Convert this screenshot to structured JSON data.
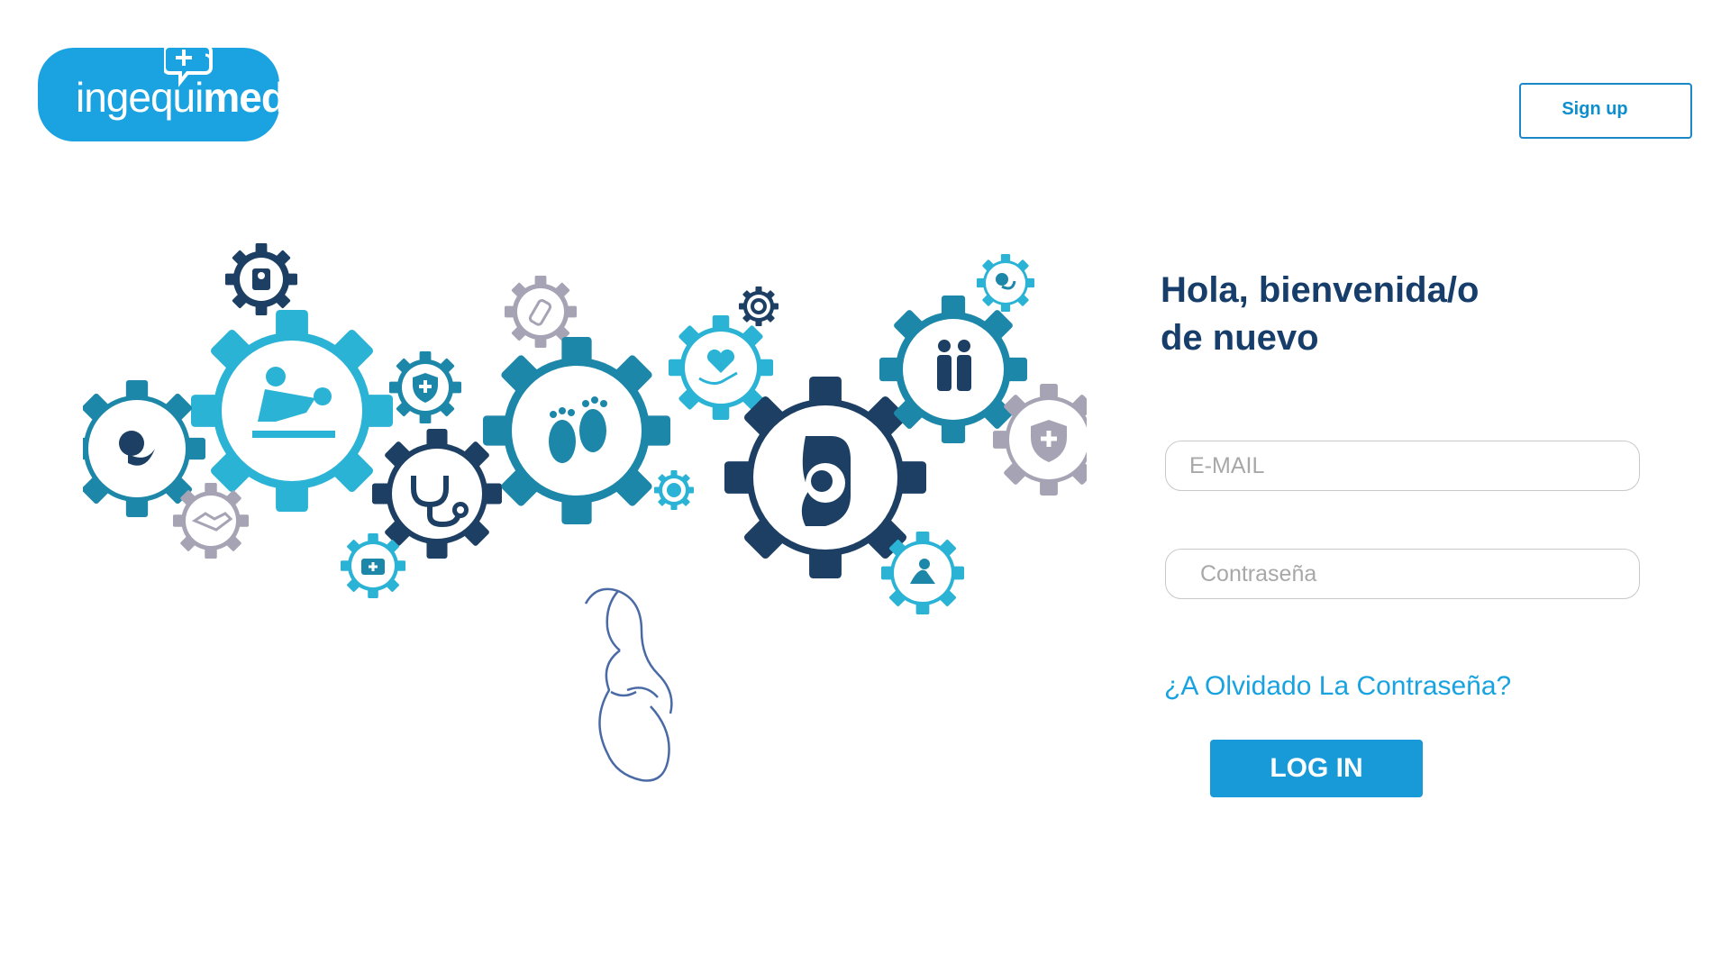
{
  "brand": {
    "name_light": "ingequi",
    "name_bold": "med",
    "color": "#1aa3e0"
  },
  "header": {
    "signup_label": "Sign up"
  },
  "welcome": {
    "line1": "Hola, bienvenida/o",
    "line2": "de nuevo",
    "color": "#173e6a"
  },
  "form": {
    "email_placeholder": "E-MAIL",
    "password_placeholder": "Contraseña",
    "forgot_label": "¿A Olvidado La Contraseña?",
    "login_label": "LOG IN"
  },
  "colors": {
    "accent": "#189ad8",
    "navy": "#173e6a",
    "gear_dark": "#1c3f63",
    "gear_teal": "#1c87a8",
    "gear_light": "#2bb3d6",
    "gear_gray": "#a6a3b4"
  },
  "icons": [
    "logo-bubble-plus-icon",
    "scale-icon",
    "mother-child-icon",
    "fetus-icon",
    "handshake-icon",
    "shield-plus-icon",
    "stethoscope-icon",
    "baby-bottle-icon",
    "footprints-icon",
    "heart-hand-icon",
    "pregnancy-fetus-icon",
    "family-icon",
    "medical-kit-icon",
    "baby-icon",
    "pregnant-woman-icon"
  ]
}
